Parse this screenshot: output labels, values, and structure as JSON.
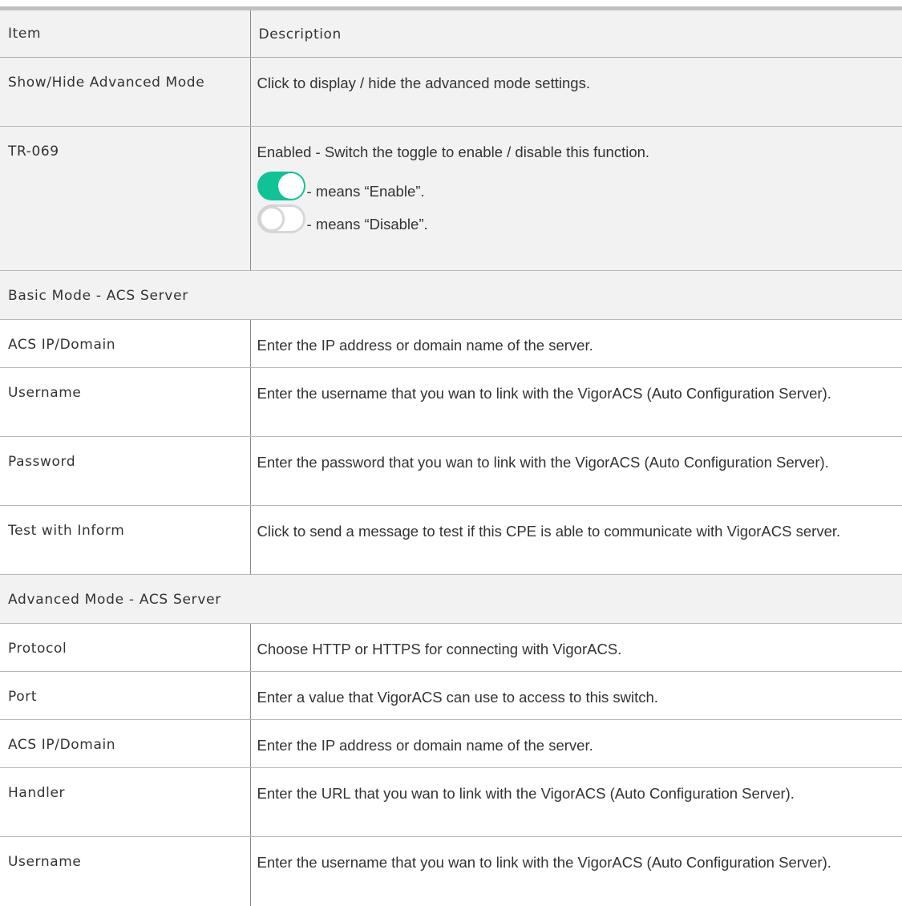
{
  "header": {
    "item": "Item",
    "description": "Description"
  },
  "rows": {
    "show_hide": {
      "item": "Show/Hide Advanced Mode",
      "desc": "Click to display / hide the advanced mode settings."
    },
    "tr069": {
      "item": "TR-069",
      "desc": "Enabled - Switch the toggle to enable / disable this function.",
      "enable_text": "- means “Enable”.",
      "disable_text": "- means “Disable”.",
      "enable_color": "#10c396",
      "disable_color": "#d7d7d7"
    }
  },
  "basic_section": {
    "title": "Basic Mode - ACS Server",
    "rows": [
      {
        "item": "ACS IP/Domain",
        "desc": "Enter the IP address or domain name of the server."
      },
      {
        "item": "Username",
        "desc": "Enter the username that you wan to link with the VigorACS (Auto Configuration Server)."
      },
      {
        "item": "Password",
        "desc": "Enter the password that you wan to link with the VigorACS (Auto Configuration Server)."
      },
      {
        "item": "Test with Inform",
        "desc": "Click to send a message to test if this CPE is able to communicate with VigorACS server."
      }
    ]
  },
  "advanced_section": {
    "title": "Advanced Mode - ACS Server",
    "rows": [
      {
        "item": "Protocol",
        "desc": "Choose HTTP or HTTPS for connecting with VigorACS."
      },
      {
        "item": "Port",
        "desc": "Enter a value that VigorACS can use to access to this switch."
      },
      {
        "item": "ACS IP/Domain",
        "desc": "Enter the IP address or domain name of the server."
      },
      {
        "item": "Handler",
        "desc": "Enter the URL that you wan to link with the VigorACS (Auto Configuration Server)."
      },
      {
        "item": "Username",
        "desc": "Enter the username that you wan to link with the VigorACS (Auto Configuration Server)."
      }
    ]
  }
}
